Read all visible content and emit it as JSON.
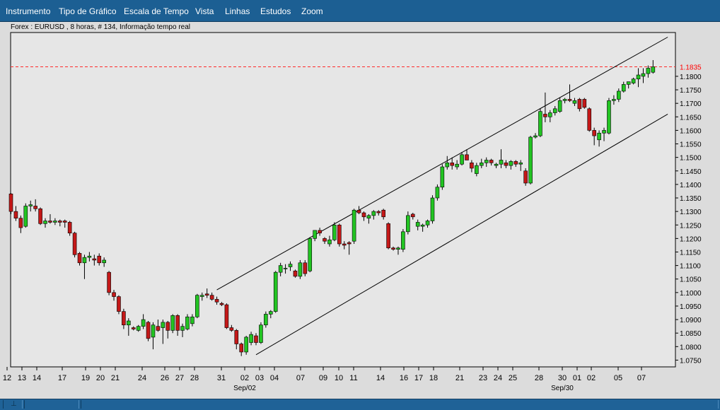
{
  "menu": {
    "items": [
      "Instrumento",
      "Tipo de Gráfico",
      "Escala de Tempo",
      "Vista",
      "Linhas",
      "Estudos",
      "Zoom"
    ]
  },
  "status": {
    "glyph": "⊥"
  },
  "chart_data": {
    "type": "candlestick",
    "title": "Forex : EURUSD , 8 horas, # 134, Informação tempo real",
    "ylim": [
      1.0725,
      1.1962
    ],
    "yticks": [
      "1.1800",
      "1.1750",
      "1.1700",
      "1.1650",
      "1.1600",
      "1.1550",
      "1.1500",
      "1.1450",
      "1.1400",
      "1.1350",
      "1.1300",
      "1.1250",
      "1.1200",
      "1.1150",
      "1.1100",
      "1.1050",
      "1.1000",
      "1.0950",
      "1.0900",
      "1.0850",
      "1.0800",
      "1.0750"
    ],
    "last_price": "1.1835",
    "xticks": [
      "12",
      "13",
      "14",
      "17",
      "19",
      "20",
      "21",
      "24",
      "26",
      "27",
      "28",
      "31",
      "02",
      "03",
      "04",
      "07",
      "09",
      "10",
      "11",
      "14",
      "16",
      "17",
      "18",
      "21",
      "23",
      "24",
      "25",
      "28",
      "30",
      "01",
      "02",
      "05",
      "07"
    ],
    "month_labels": [
      "Sep/02",
      "Sep/30"
    ],
    "colors": {
      "up": "#22c422",
      "down": "#c41818",
      "reference_line": "#ff2a2a",
      "price_label": "#ff0000"
    },
    "candles": [
      {
        "o": 1.1365,
        "h": 1.1368,
        "l": 1.129,
        "c": 1.13
      },
      {
        "o": 1.13,
        "h": 1.132,
        "l": 1.1265,
        "c": 1.1275
      },
      {
        "o": 1.1275,
        "h": 1.1285,
        "l": 1.122,
        "c": 1.124
      },
      {
        "o": 1.1245,
        "h": 1.133,
        "l": 1.124,
        "c": 1.132
      },
      {
        "o": 1.132,
        "h": 1.134,
        "l": 1.13,
        "c": 1.1325
      },
      {
        "o": 1.132,
        "h": 1.1345,
        "l": 1.13,
        "c": 1.131
      },
      {
        "o": 1.131,
        "h": 1.1315,
        "l": 1.125,
        "c": 1.1255
      },
      {
        "o": 1.1255,
        "h": 1.1275,
        "l": 1.124,
        "c": 1.1265
      },
      {
        "o": 1.1265,
        "h": 1.129,
        "l": 1.1255,
        "c": 1.126
      },
      {
        "o": 1.126,
        "h": 1.1275,
        "l": 1.125,
        "c": 1.1265
      },
      {
        "o": 1.1265,
        "h": 1.127,
        "l": 1.1245,
        "c": 1.126
      },
      {
        "o": 1.1265,
        "h": 1.127,
        "l": 1.124,
        "c": 1.126
      },
      {
        "o": 1.126,
        "h": 1.1265,
        "l": 1.121,
        "c": 1.122
      },
      {
        "o": 1.122,
        "h": 1.1225,
        "l": 1.113,
        "c": 1.114
      },
      {
        "o": 1.1145,
        "h": 1.115,
        "l": 1.11,
        "c": 1.111
      },
      {
        "o": 1.111,
        "h": 1.114,
        "l": 1.105,
        "c": 1.113
      },
      {
        "o": 1.113,
        "h": 1.115,
        "l": 1.1115,
        "c": 1.1135
      },
      {
        "o": 1.1125,
        "h": 1.114,
        "l": 1.11,
        "c": 1.112
      },
      {
        "o": 1.1135,
        "h": 1.1145,
        "l": 1.11,
        "c": 1.111
      },
      {
        "o": 1.111,
        "h": 1.113,
        "l": 1.1095,
        "c": 1.112
      },
      {
        "o": 1.1075,
        "h": 1.108,
        "l": 1.099,
        "c": 1.1
      },
      {
        "o": 1.1,
        "h": 1.101,
        "l": 1.097,
        "c": 1.0985
      },
      {
        "o": 1.0985,
        "h": 1.099,
        "l": 1.092,
        "c": 1.093
      },
      {
        "o": 1.093,
        "h": 1.094,
        "l": 1.0865,
        "c": 1.088
      },
      {
        "o": 1.088,
        "h": 1.0905,
        "l": 1.084,
        "c": 1.0895
      },
      {
        "o": 1.087,
        "h": 1.0875,
        "l": 1.086,
        "c": 1.0865
      },
      {
        "o": 1.086,
        "h": 1.088,
        "l": 1.0855,
        "c": 1.0875
      },
      {
        "o": 1.0875,
        "h": 1.092,
        "l": 1.0865,
        "c": 1.09
      },
      {
        "o": 1.089,
        "h": 1.0895,
        "l": 1.082,
        "c": 1.083
      },
      {
        "o": 1.0835,
        "h": 1.089,
        "l": 1.079,
        "c": 1.088
      },
      {
        "o": 1.0875,
        "h": 1.09,
        "l": 1.0855,
        "c": 1.086
      },
      {
        "o": 1.087,
        "h": 1.09,
        "l": 1.081,
        "c": 1.089
      },
      {
        "o": 1.089,
        "h": 1.0895,
        "l": 1.083,
        "c": 1.086
      },
      {
        "o": 1.086,
        "h": 1.092,
        "l": 1.085,
        "c": 1.0915
      },
      {
        "o": 1.0915,
        "h": 1.092,
        "l": 1.084,
        "c": 1.086
      },
      {
        "o": 1.086,
        "h": 1.0885,
        "l": 1.0835,
        "c": 1.0875
      },
      {
        "o": 1.0865,
        "h": 1.092,
        "l": 1.086,
        "c": 1.091
      },
      {
        "o": 1.0885,
        "h": 1.092,
        "l": 1.0875,
        "c": 1.091
      },
      {
        "o": 1.091,
        "h": 1.0995,
        "l": 1.0905,
        "c": 1.099
      },
      {
        "o": 1.0985,
        "h": 1.1,
        "l": 1.097,
        "c": 1.099
      },
      {
        "o": 1.0995,
        "h": 1.1015,
        "l": 1.098,
        "c": 1.099
      },
      {
        "o": 1.099,
        "h": 1.1,
        "l": 1.097,
        "c": 1.0975
      },
      {
        "o": 1.0975,
        "h": 1.0985,
        "l": 1.0955,
        "c": 1.0965
      },
      {
        "o": 1.096,
        "h": 1.0965,
        "l": 1.095,
        "c": 1.0955
      },
      {
        "o": 1.0955,
        "h": 1.096,
        "l": 1.0865,
        "c": 1.087
      },
      {
        "o": 1.087,
        "h": 1.088,
        "l": 1.0855,
        "c": 1.086
      },
      {
        "o": 1.086,
        "h": 1.0865,
        "l": 1.079,
        "c": 1.081
      },
      {
        "o": 1.081,
        "h": 1.0815,
        "l": 1.0765,
        "c": 1.078
      },
      {
        "o": 1.078,
        "h": 1.084,
        "l": 1.077,
        "c": 1.0835
      },
      {
        "o": 1.0815,
        "h": 1.0855,
        "l": 1.0805,
        "c": 1.0845
      },
      {
        "o": 1.084,
        "h": 1.085,
        "l": 1.0805,
        "c": 1.0815
      },
      {
        "o": 1.0815,
        "h": 1.089,
        "l": 1.081,
        "c": 1.088
      },
      {
        "o": 1.088,
        "h": 1.093,
        "l": 1.087,
        "c": 1.092
      },
      {
        "o": 1.092,
        "h": 1.0935,
        "l": 1.0905,
        "c": 1.093
      },
      {
        "o": 1.093,
        "h": 1.108,
        "l": 1.0925,
        "c": 1.1075
      },
      {
        "o": 1.1075,
        "h": 1.111,
        "l": 1.106,
        "c": 1.11
      },
      {
        "o": 1.109,
        "h": 1.1105,
        "l": 1.107,
        "c": 1.109
      },
      {
        "o": 1.1095,
        "h": 1.1115,
        "l": 1.108,
        "c": 1.1105
      },
      {
        "o": 1.108,
        "h": 1.1085,
        "l": 1.1055,
        "c": 1.106
      },
      {
        "o": 1.106,
        "h": 1.112,
        "l": 1.105,
        "c": 1.111
      },
      {
        "o": 1.111,
        "h": 1.112,
        "l": 1.106,
        "c": 1.107
      },
      {
        "o": 1.108,
        "h": 1.1205,
        "l": 1.1075,
        "c": 1.12
      },
      {
        "o": 1.12,
        "h": 1.123,
        "l": 1.119,
        "c": 1.123
      },
      {
        "o": 1.123,
        "h": 1.124,
        "l": 1.121,
        "c": 1.122
      },
      {
        "o": 1.12,
        "h": 1.1205,
        "l": 1.118,
        "c": 1.119
      },
      {
        "o": 1.118,
        "h": 1.121,
        "l": 1.117,
        "c": 1.1195
      },
      {
        "o": 1.1195,
        "h": 1.126,
        "l": 1.119,
        "c": 1.125
      },
      {
        "o": 1.125,
        "h": 1.1255,
        "l": 1.117,
        "c": 1.118
      },
      {
        "o": 1.118,
        "h": 1.119,
        "l": 1.116,
        "c": 1.1175
      },
      {
        "o": 1.1185,
        "h": 1.119,
        "l": 1.114,
        "c": 1.118
      },
      {
        "o": 1.119,
        "h": 1.131,
        "l": 1.118,
        "c": 1.1305
      },
      {
        "o": 1.1305,
        "h": 1.132,
        "l": 1.129,
        "c": 1.1295
      },
      {
        "o": 1.1295,
        "h": 1.13,
        "l": 1.1265,
        "c": 1.128
      },
      {
        "o": 1.1275,
        "h": 1.129,
        "l": 1.1255,
        "c": 1.1285
      },
      {
        "o": 1.1285,
        "h": 1.1305,
        "l": 1.127,
        "c": 1.13
      },
      {
        "o": 1.13,
        "h": 1.1305,
        "l": 1.1285,
        "c": 1.1295
      },
      {
        "o": 1.1305,
        "h": 1.131,
        "l": 1.127,
        "c": 1.128
      },
      {
        "o": 1.1255,
        "h": 1.126,
        "l": 1.116,
        "c": 1.1165
      },
      {
        "o": 1.1165,
        "h": 1.117,
        "l": 1.1155,
        "c": 1.116
      },
      {
        "o": 1.116,
        "h": 1.117,
        "l": 1.114,
        "c": 1.1165
      },
      {
        "o": 1.116,
        "h": 1.1235,
        "l": 1.115,
        "c": 1.1225
      },
      {
        "o": 1.1225,
        "h": 1.13,
        "l": 1.1215,
        "c": 1.1285
      },
      {
        "o": 1.129,
        "h": 1.1295,
        "l": 1.127,
        "c": 1.128
      },
      {
        "o": 1.1245,
        "h": 1.127,
        "l": 1.123,
        "c": 1.126
      },
      {
        "o": 1.1245,
        "h": 1.1255,
        "l": 1.1225,
        "c": 1.125
      },
      {
        "o": 1.125,
        "h": 1.127,
        "l": 1.124,
        "c": 1.1265
      },
      {
        "o": 1.1265,
        "h": 1.136,
        "l": 1.1255,
        "c": 1.135
      },
      {
        "o": 1.135,
        "h": 1.14,
        "l": 1.134,
        "c": 1.139
      },
      {
        "o": 1.139,
        "h": 1.1475,
        "l": 1.138,
        "c": 1.1465
      },
      {
        "o": 1.1465,
        "h": 1.1505,
        "l": 1.1455,
        "c": 1.148
      },
      {
        "o": 1.148,
        "h": 1.15,
        "l": 1.1455,
        "c": 1.147
      },
      {
        "o": 1.1465,
        "h": 1.149,
        "l": 1.1455,
        "c": 1.1475
      },
      {
        "o": 1.1475,
        "h": 1.152,
        "l": 1.147,
        "c": 1.151
      },
      {
        "o": 1.151,
        "h": 1.153,
        "l": 1.149,
        "c": 1.149
      },
      {
        "o": 1.148,
        "h": 1.149,
        "l": 1.1445,
        "c": 1.146
      },
      {
        "o": 1.144,
        "h": 1.148,
        "l": 1.143,
        "c": 1.147
      },
      {
        "o": 1.147,
        "h": 1.1495,
        "l": 1.146,
        "c": 1.148
      },
      {
        "o": 1.148,
        "h": 1.15,
        "l": 1.1465,
        "c": 1.149
      },
      {
        "o": 1.149,
        "h": 1.1495,
        "l": 1.147,
        "c": 1.148
      },
      {
        "o": 1.147,
        "h": 1.148,
        "l": 1.146,
        "c": 1.1475
      },
      {
        "o": 1.1475,
        "h": 1.153,
        "l": 1.146,
        "c": 1.149
      },
      {
        "o": 1.148,
        "h": 1.149,
        "l": 1.146,
        "c": 1.147
      },
      {
        "o": 1.147,
        "h": 1.149,
        "l": 1.1455,
        "c": 1.1485
      },
      {
        "o": 1.1485,
        "h": 1.149,
        "l": 1.1465,
        "c": 1.1475
      },
      {
        "o": 1.1475,
        "h": 1.149,
        "l": 1.145,
        "c": 1.148
      },
      {
        "o": 1.145,
        "h": 1.146,
        "l": 1.1395,
        "c": 1.1405
      },
      {
        "o": 1.1405,
        "h": 1.158,
        "l": 1.14,
        "c": 1.1575
      },
      {
        "o": 1.1575,
        "h": 1.159,
        "l": 1.157,
        "c": 1.158
      },
      {
        "o": 1.158,
        "h": 1.168,
        "l": 1.1575,
        "c": 1.167
      },
      {
        "o": 1.166,
        "h": 1.174,
        "l": 1.163,
        "c": 1.165
      },
      {
        "o": 1.165,
        "h": 1.1675,
        "l": 1.163,
        "c": 1.1665
      },
      {
        "o": 1.1665,
        "h": 1.169,
        "l": 1.1655,
        "c": 1.168
      },
      {
        "o": 1.167,
        "h": 1.172,
        "l": 1.1665,
        "c": 1.171
      },
      {
        "o": 1.171,
        "h": 1.172,
        "l": 1.17,
        "c": 1.1715
      },
      {
        "o": 1.1715,
        "h": 1.177,
        "l": 1.1705,
        "c": 1.171
      },
      {
        "o": 1.17,
        "h": 1.172,
        "l": 1.169,
        "c": 1.171
      },
      {
        "o": 1.1715,
        "h": 1.172,
        "l": 1.167,
        "c": 1.168
      },
      {
        "o": 1.1715,
        "h": 1.172,
        "l": 1.168,
        "c": 1.1685
      },
      {
        "o": 1.168,
        "h": 1.1685,
        "l": 1.1595,
        "c": 1.16
      },
      {
        "o": 1.16,
        "h": 1.161,
        "l": 1.1545,
        "c": 1.158
      },
      {
        "o": 1.1565,
        "h": 1.16,
        "l": 1.154,
        "c": 1.159
      },
      {
        "o": 1.159,
        "h": 1.161,
        "l": 1.156,
        "c": 1.16
      },
      {
        "o": 1.159,
        "h": 1.172,
        "l": 1.1585,
        "c": 1.171
      },
      {
        "o": 1.171,
        "h": 1.173,
        "l": 1.1695,
        "c": 1.1715
      },
      {
        "o": 1.1715,
        "h": 1.1755,
        "l": 1.1705,
        "c": 1.1745
      },
      {
        "o": 1.1745,
        "h": 1.178,
        "l": 1.174,
        "c": 1.177
      },
      {
        "o": 1.177,
        "h": 1.178,
        "l": 1.1755,
        "c": 1.178
      },
      {
        "o": 1.1775,
        "h": 1.1795,
        "l": 1.177,
        "c": 1.179
      },
      {
        "o": 1.179,
        "h": 1.183,
        "l": 1.176,
        "c": 1.1805
      },
      {
        "o": 1.18,
        "h": 1.183,
        "l": 1.1775,
        "c": 1.181
      },
      {
        "o": 1.181,
        "h": 1.184,
        "l": 1.1795,
        "c": 1.183
      },
      {
        "o": 1.1815,
        "h": 1.186,
        "l": 1.181,
        "c": 1.1835
      }
    ],
    "channel": {
      "upper": [
        {
          "i": 42,
          "p": 1.101
        },
        {
          "i": 134,
          "p": 1.1945
        }
      ],
      "lower": [
        {
          "i": 50,
          "p": 1.077
        },
        {
          "i": 134,
          "p": 1.166
        }
      ]
    }
  }
}
